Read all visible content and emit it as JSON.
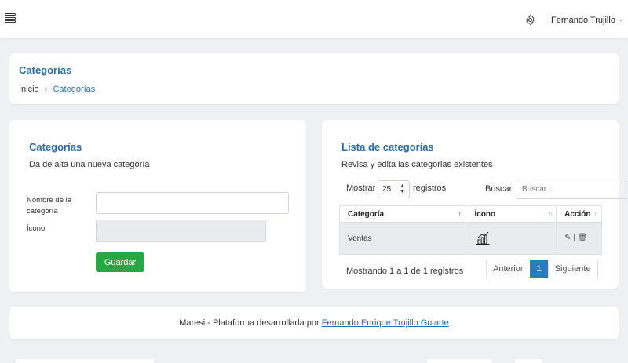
{
  "topbar": {
    "user_name": "Fernando Trujillo",
    "icons": [
      "menu-icon",
      "gear-icon",
      "chevron-down-icon"
    ]
  },
  "header": {
    "title": "Categorías",
    "breadcrumb": [
      "Inicio",
      "Categorías"
    ]
  },
  "form_card": {
    "title": "Categorías",
    "subtitle": "Da de alta una nueva categoría",
    "name_label": "Nombre de la categoría",
    "name_value": "",
    "icon_label": "Ícono",
    "icon_value": "",
    "save_label": "Guardar"
  },
  "list_card": {
    "title": "Lista de categorías",
    "subtitle": "Revisa y edita las categorias existentes",
    "show_label": "Mostrar",
    "page_size": "25",
    "records_label": "registros",
    "search_label": "Buscar:",
    "search_placeholder": "Buscar...",
    "columns": [
      "Categoría",
      "Ícono",
      "Acción"
    ],
    "rows": [
      {
        "categoria": "Ventas",
        "icono": "bar-chart-icon",
        "accion": "|"
      }
    ],
    "info": "Mostrando 1 a 1 de 1 registros",
    "pager": {
      "prev": "Anterior",
      "current": "1",
      "next": "Siguiente"
    }
  },
  "footer": {
    "text": "Maresi - Plataforma desarrollada por ",
    "link": "Fernando Enrique Trujillo Guiarte"
  },
  "colors": {
    "accent": "#2a6ea6",
    "primary": "#2a7ac0",
    "success": "#28a745",
    "background": "#eef0f3"
  }
}
